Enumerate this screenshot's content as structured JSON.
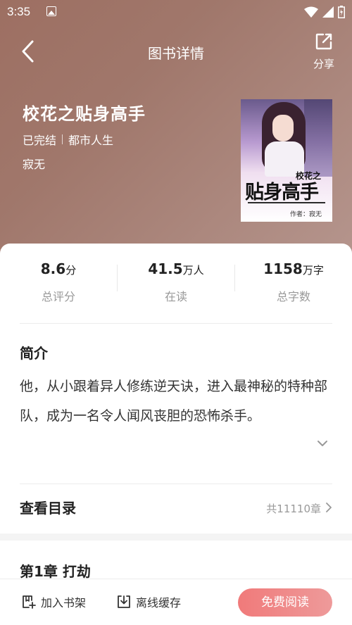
{
  "status_bar": {
    "time": "3:35"
  },
  "header": {
    "title": "图书详情",
    "share_label": "分享"
  },
  "book": {
    "title": "校花之贴身高手",
    "status": "已完结",
    "category": "都市人生",
    "author": "寂无",
    "cover": {
      "small_text": "校花之",
      "big_text": "贴身高手",
      "author_text": "作者：寂无"
    }
  },
  "stats": [
    {
      "value": "8.6",
      "unit": "分",
      "label": "总评分"
    },
    {
      "value": "41.5",
      "unit": "万人",
      "label": "在读"
    },
    {
      "value": "1158",
      "unit": "万字",
      "label": "总字数"
    }
  ],
  "intro": {
    "title": "简介",
    "text": "他，从小跟着异人修练逆天诀，进入最神秘的特种部队，成为一名令人闻风丧胆的恐怖杀手。"
  },
  "toc": {
    "label": "查看目录",
    "count": "共11110章"
  },
  "chapter": {
    "title": "第1章 打劫"
  },
  "bottom_bar": {
    "add_shelf": "加入书架",
    "offline_cache": "离线缓存",
    "read": "免费阅读"
  },
  "colors": {
    "hero_bg": "#a0776b",
    "read_button": "#f07a7a",
    "muted_text": "#999999"
  }
}
